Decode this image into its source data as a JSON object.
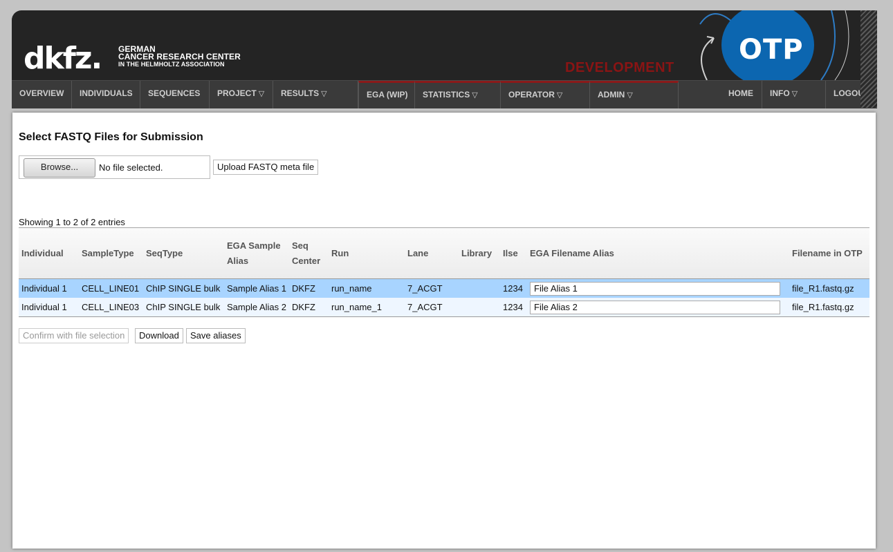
{
  "header": {
    "logo_mark": "dkfz.",
    "logo_line1": "GERMAN",
    "logo_line2": "CANCER RESEARCH CENTER",
    "logo_line3": "IN THE HELMHOLTZ ASSOCIATION",
    "environment": "DEVELOPMENT",
    "app_logo": "OTP"
  },
  "nav": {
    "overview": "OVERVIEW",
    "individuals": "INDIVIDUALS",
    "sequences": "SEQUENCES",
    "project": "PROJECT",
    "results": "RESULTS",
    "ega": "EGA (WIP)",
    "statistics": "STATISTICS",
    "operator": "OPERATOR",
    "admin": "ADMIN",
    "home": "HOME",
    "info": "INFO",
    "logout": "LOGOUT",
    "dropdown_glyph": "▽"
  },
  "page": {
    "title": "Select FASTQ Files for Submission",
    "browse_label": "Browse...",
    "file_status": "No file selected.",
    "upload_label": "Upload FASTQ meta file",
    "showing": "Showing 1 to 2 of 2 entries"
  },
  "table": {
    "headers": {
      "individual": "Individual",
      "sample_type": "SampleType",
      "seq_type": "SeqType",
      "ega_sample_alias": "EGA Sample Alias",
      "seq_center": "Seq Center",
      "run": "Run",
      "lane": "Lane",
      "library": "Library",
      "ilse": "Ilse",
      "ega_filename_alias": "EGA Filename Alias",
      "filename_in_otp": "Filename in OTP"
    },
    "rows": [
      {
        "individual": "Individual 1",
        "sample_type": "CELL_LINE01",
        "seq_type": "ChIP SINGLE bulk",
        "ega_sample_alias": "Sample Alias 1",
        "seq_center": "DKFZ",
        "run": "run_name",
        "lane": "7_ACGT",
        "library": "",
        "ilse": "1234",
        "ega_filename_alias": "File Alias 1",
        "filename_in_otp": "file_R1.fastq.gz"
      },
      {
        "individual": "Individual 1",
        "sample_type": "CELL_LINE03",
        "seq_type": "ChIP SINGLE bulk",
        "ega_sample_alias": "Sample Alias 2",
        "seq_center": "DKFZ",
        "run": "run_name_1",
        "lane": "7_ACGT",
        "library": "",
        "ilse": "1234",
        "ega_filename_alias": "File Alias 2",
        "filename_in_otp": "file_R1.fastq.gz"
      }
    ]
  },
  "actions": {
    "confirm": "Confirm with file selection",
    "download": "Download",
    "save_aliases": "Save aliases"
  },
  "colors": {
    "header_bg": "#242424",
    "otp_blue": "#0c66b0",
    "environment_red": "#8a1414",
    "selected_row": "#a8d4ff"
  }
}
